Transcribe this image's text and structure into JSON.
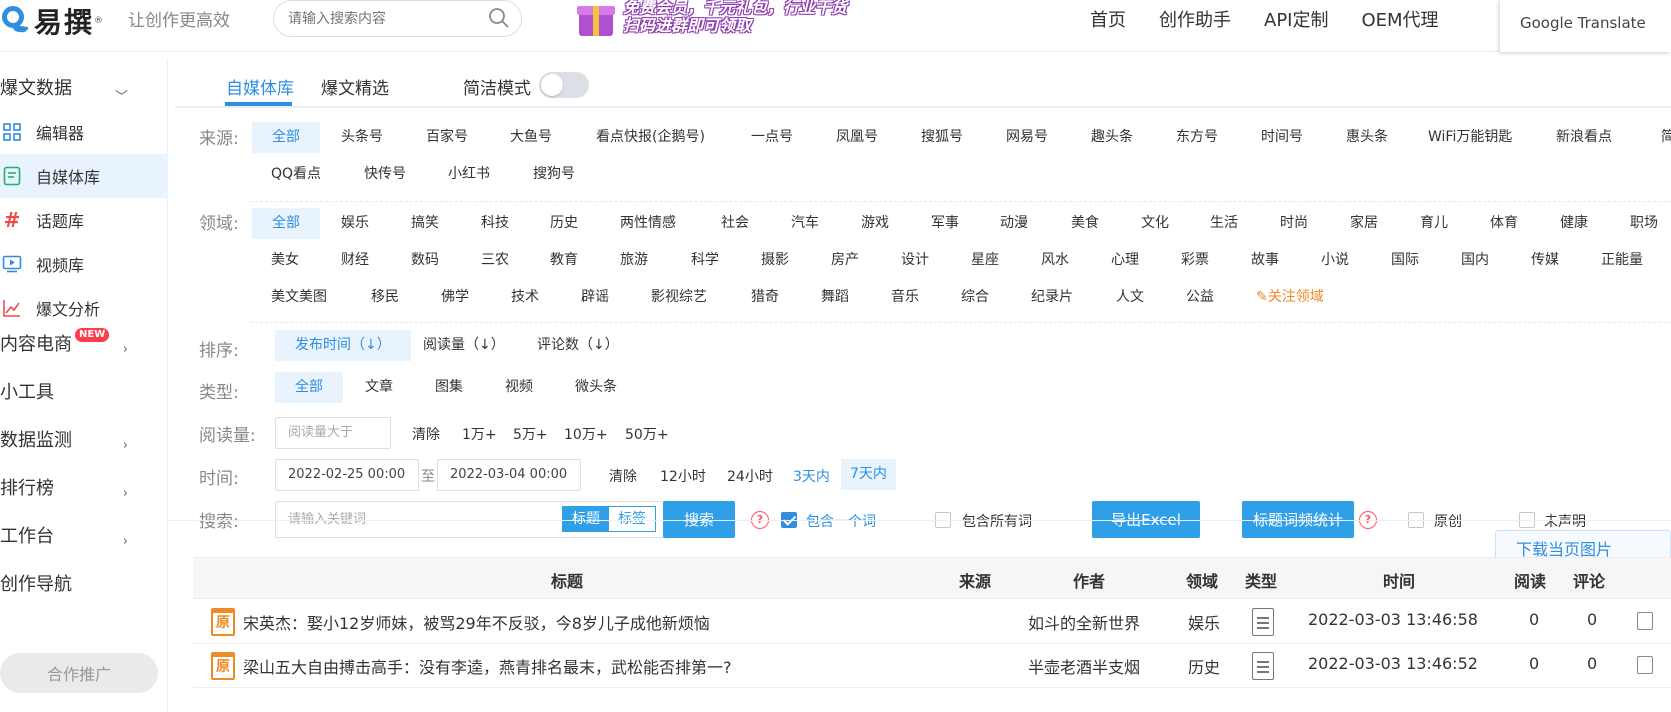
{
  "header": {
    "logo_text": "易撰",
    "slogan": "让创作更高效",
    "search_placeholder": "请输入搜索内容",
    "promo_line1": "免费会员，千元礼包，行业干货",
    "promo_line2": "扫码进群即可领取",
    "nav": [
      "首页",
      "创作助手",
      "API定制",
      "OEM代理"
    ],
    "google_translate": "Google Translate"
  },
  "sidebar": {
    "group_baowen": "爆文数据",
    "items": [
      {
        "label": "编辑器",
        "icon": "grid-icon"
      },
      {
        "label": "自媒体库",
        "icon": "document-icon"
      },
      {
        "label": "话题库",
        "icon": "hashtag-icon"
      },
      {
        "label": "视频库",
        "icon": "video-icon"
      },
      {
        "label": "爆文分析",
        "icon": "chart-icon"
      }
    ],
    "content_ecommerce": "内容电商",
    "new_badge": "NEW",
    "tools": "小工具",
    "monitoring": "数据监测",
    "ranking": "排行榜",
    "workbench": "工作台",
    "creation_nav": "创作导航",
    "coop_button": "合作推广"
  },
  "tabs": {
    "media_lib": "自媒体库",
    "selected": "爆文精选",
    "simple_mode": "简洁模式"
  },
  "filters": {
    "source_label": "来源:",
    "sources_row1": [
      "全部",
      "头条号",
      "百家号",
      "大鱼号",
      "看点快报(企鹅号)",
      "一点号",
      "凤凰号",
      "搜狐号",
      "网易号",
      "趣头条",
      "东方号",
      "时间号",
      "惠头条",
      "WiFi万能钥匙",
      "新浪看点",
      "简"
    ],
    "sources_row2": [
      "QQ看点",
      "快传号",
      "小红书",
      "搜狗号"
    ],
    "domain_label": "领域:",
    "domains_row1": [
      "全部",
      "娱乐",
      "搞笑",
      "科技",
      "历史",
      "两性情感",
      "社会",
      "汽车",
      "游戏",
      "军事",
      "动漫",
      "美食",
      "文化",
      "生活",
      "时尚",
      "家居",
      "育儿",
      "体育",
      "健康",
      "职场"
    ],
    "domains_row2": [
      "美女",
      "财经",
      "数码",
      "三农",
      "教育",
      "旅游",
      "科学",
      "摄影",
      "房产",
      "设计",
      "星座",
      "风水",
      "心理",
      "彩票",
      "故事",
      "小说",
      "国际",
      "国内",
      "传媒",
      "正能量"
    ],
    "domains_row3": [
      "美文美图",
      "移民",
      "佛学",
      "技术",
      "辟谣",
      "影视综艺",
      "猎奇",
      "舞蹈",
      "音乐",
      "综合",
      "纪录片",
      "人文",
      "公益"
    ],
    "follow_domain": "关注领域",
    "sort_label": "排序:",
    "sorts": [
      "发布时间（↓）",
      "阅读量（↓）",
      "评论数（↓）"
    ],
    "type_label": "类型:",
    "types": [
      "全部",
      "文章",
      "图集",
      "视频",
      "微头条"
    ],
    "read_label": "阅读量:",
    "read_placeholder": "阅读量大于",
    "read_options": [
      "清除",
      "1万+",
      "5万+",
      "10万+",
      "50万+"
    ],
    "time_label": "时间:",
    "time_from": "2022-02-25 00:00",
    "time_to_sep": "至",
    "time_to": "2022-03-04 00:00",
    "time_options": [
      "清除",
      "12小时",
      "24小时",
      "3天内",
      "7天内"
    ],
    "search_label": "搜索:",
    "keyword_placeholder": "请输入关键词",
    "seg_title": "标题",
    "seg_tag": "标签",
    "search_button": "搜索",
    "contains_one": "包含一个词",
    "contains_all": "包含所有词",
    "export_button": "导出Excel",
    "word_freq_button": "标题词频统计",
    "original": "原创",
    "undeclared": "未声明"
  },
  "download_button": "下载当页图片",
  "table": {
    "columns": [
      "标题",
      "来源",
      "作者",
      "领域",
      "类型",
      "时间",
      "阅读",
      "评论"
    ],
    "rows": [
      {
        "badge": "原",
        "title": "宋英杰：娶小12岁师妹，被骂29年不反驳，今8岁儿子成他新烦恼",
        "author": "如斗的全新世界",
        "domain": "娱乐",
        "time": "2022-03-03 13:46:58",
        "reads": "0",
        "comments": "0"
      },
      {
        "badge": "原",
        "title": "梁山五大自由搏击高手：没有李逵，燕青排名最末，武松能否排第一?",
        "author": "半壶老酒半支烟",
        "domain": "历史",
        "time": "2022-03-03 13:46:52",
        "reads": "0",
        "comments": "0"
      }
    ]
  }
}
